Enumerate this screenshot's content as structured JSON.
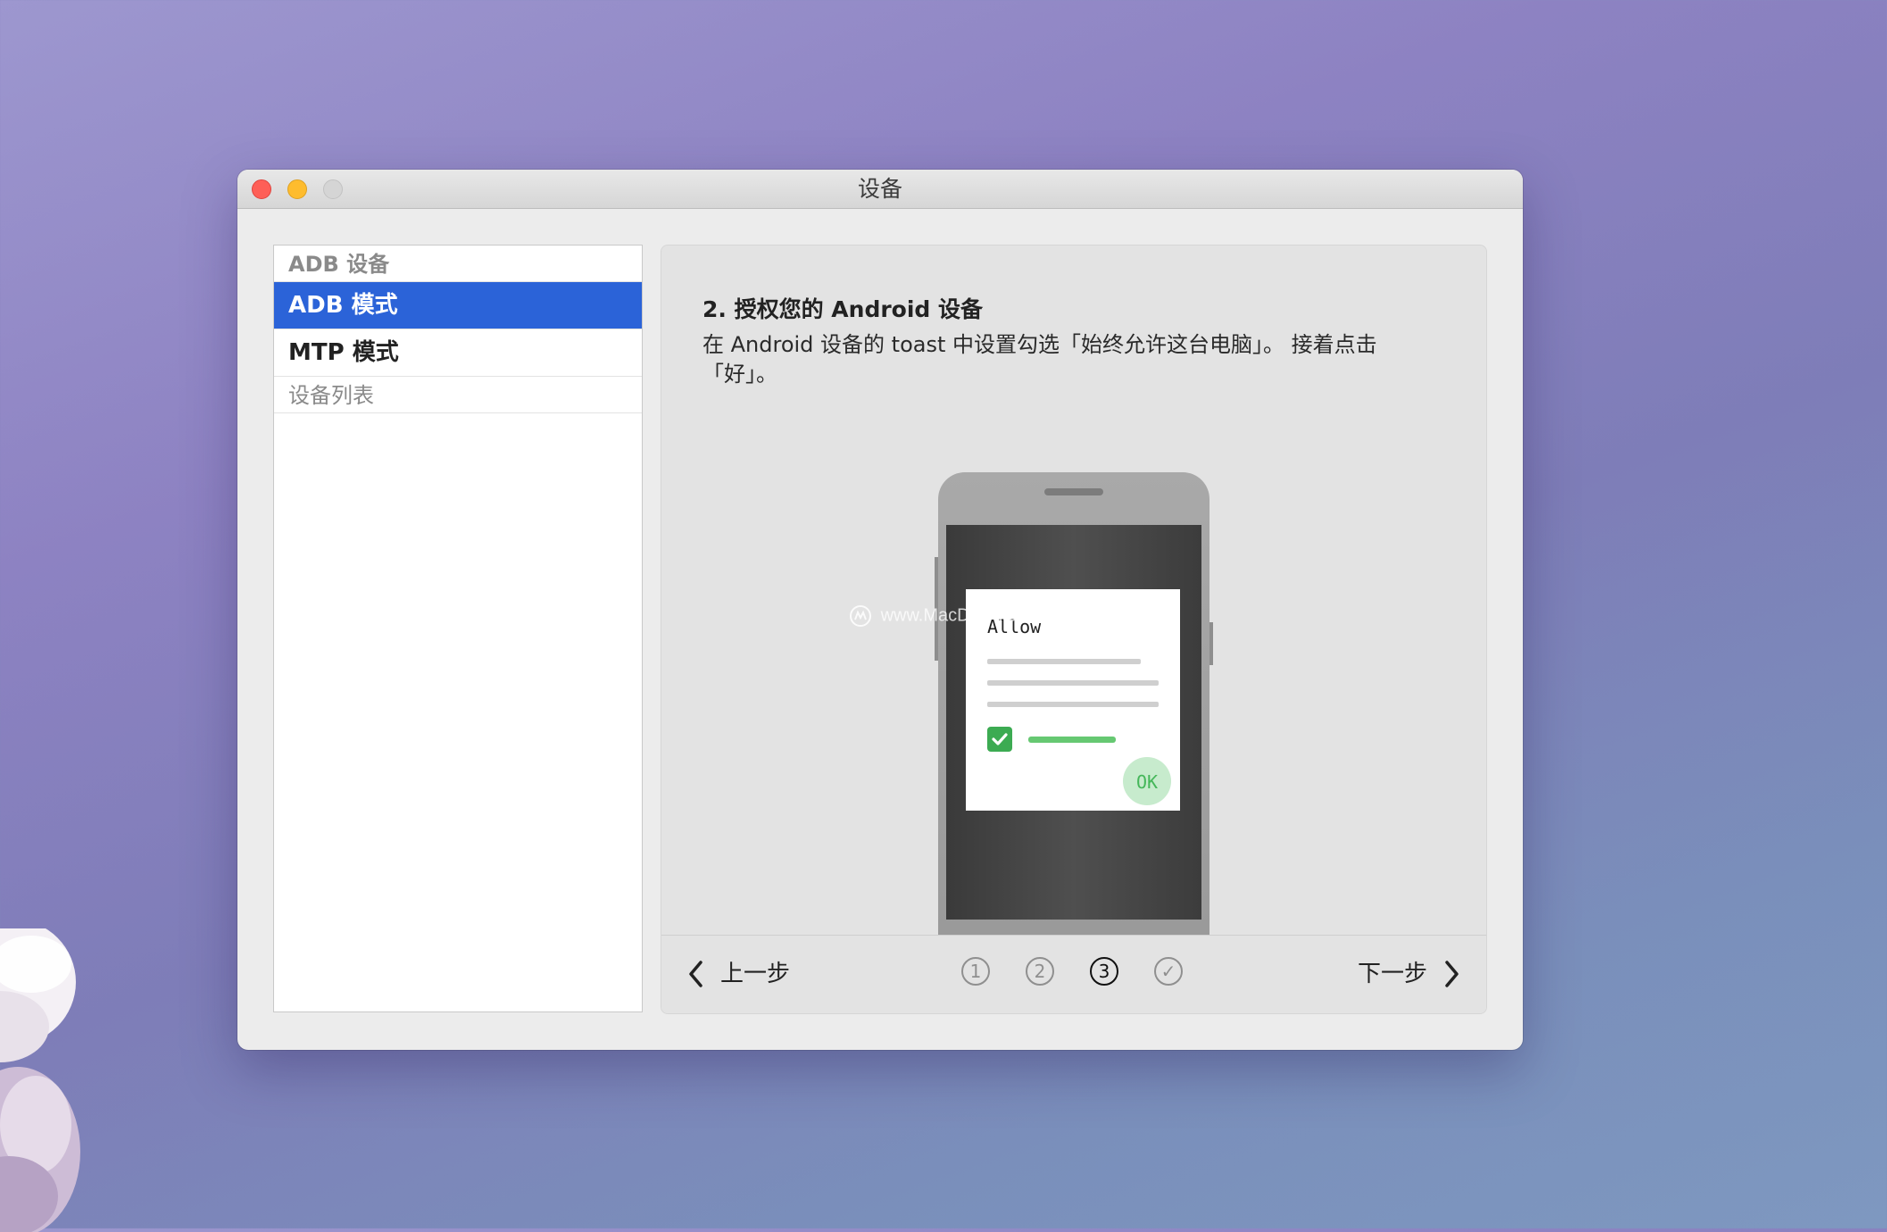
{
  "window": {
    "title": "设备"
  },
  "sidebar": {
    "group_adb": "ADB 设备",
    "items": [
      {
        "label": "ADB 模式",
        "selected": true
      },
      {
        "label": "MTP 模式",
        "selected": false
      }
    ],
    "group_devices": "设备列表"
  },
  "content": {
    "heading": "2. 授权您的 Android 设备",
    "description": "在 Android 设备的 toast 中设置勾选「始终允许这台电脑」。 接着点击「好」。",
    "illustration": {
      "dialog_title": "Allow",
      "ok_label": "OK",
      "checkbox_color": "#3cab52"
    },
    "watermark": "www.MacDown.com"
  },
  "footer": {
    "prev_label": "上一步",
    "next_label": "下一步",
    "steps": [
      "1",
      "2",
      "3",
      "✓"
    ],
    "active_step": 3
  },
  "colors": {
    "accent": "#2b63d8",
    "close": "#fe5f57",
    "minimize": "#febc2e",
    "maximize": "#d5d5d5"
  }
}
